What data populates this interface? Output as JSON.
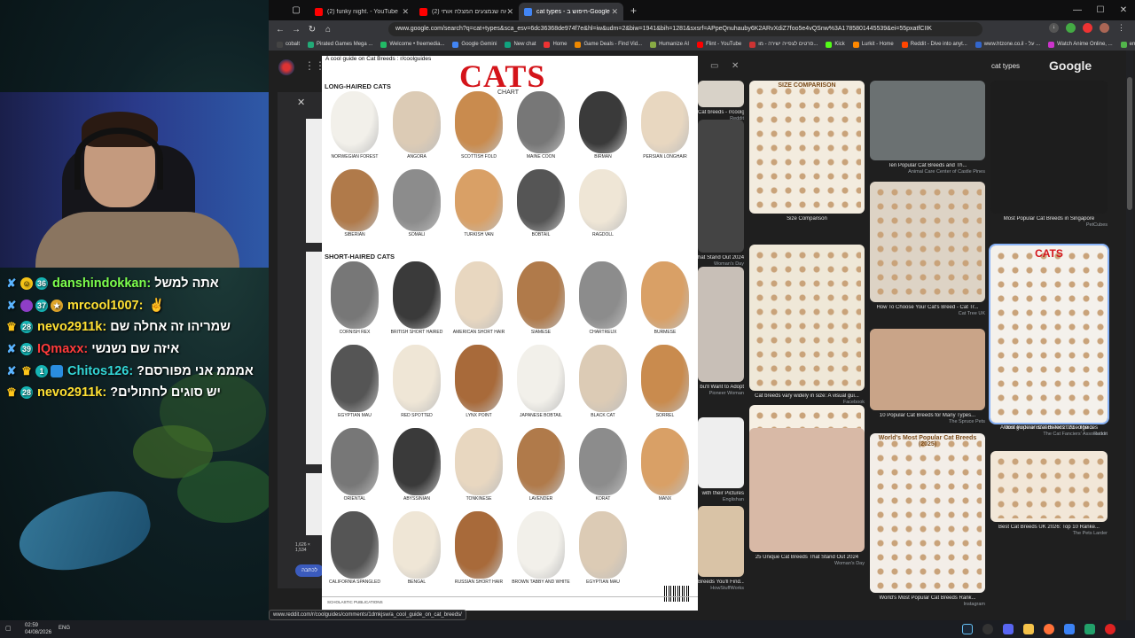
{
  "browser": {
    "tabs": [
      {
        "label": "(2) funky night. - YouTube",
        "color": "#ff0000",
        "active": false
      },
      {
        "label": "(2) הפיגאה שנמצעים המצלה אותי",
        "color": "#ff0000",
        "active": false
      },
      {
        "label": "cat types - חיפוש ב-Google",
        "color": "#4285f4",
        "active": true
      }
    ],
    "new_tab": "+",
    "address": "www.google.com/search?q=cat+types&sca_esv=6dc36368de974f7e&hl=iw&udm=2&biw=1941&bih=1281&sxsrf=APpeQnuhauby6K2ARvXdiZ7foo5e4vQSnw%3A1785801445539&ei=55pxatfCIIK",
    "bookmarks": [
      {
        "label": "cobalt",
        "color": "#444"
      },
      {
        "label": "Pirated Games Mega ...",
        "color": "#2a7"
      },
      {
        "label": "Welcome • freemedia...",
        "color": "#2b6"
      },
      {
        "label": "Google Gemini",
        "color": "#4285f4"
      },
      {
        "label": "New chat",
        "color": "#10a37f"
      },
      {
        "label": "Home",
        "color": "#e33"
      },
      {
        "label": "Game Deals - Find Vid...",
        "color": "#e80"
      },
      {
        "label": "Humanize AI",
        "color": "#8a4"
      },
      {
        "label": "Flint - YouTube",
        "color": "#f00"
      },
      {
        "label": "סרטים לצפייה ישירה - מו...",
        "color": "#c33"
      },
      {
        "label": "Kick",
        "color": "#53fc18"
      },
      {
        "label": "Lurkit - Home",
        "color": "#f80"
      },
      {
        "label": "Reddit - Dive into anyt...",
        "color": "#ff4500"
      },
      {
        "label": "www.htzone.co.il - על ...",
        "color": "#36c"
      },
      {
        "label": "Watch Anime Online, ...",
        "color": "#c3c"
      },
      {
        "label": "embyILTV",
        "color": "#52b54b"
      }
    ]
  },
  "search": {
    "query": "cat types",
    "logo": "Google"
  },
  "preview": {
    "caption": "A cool guide on Cat Breeds : r/coolguides",
    "title": "CATS",
    "subtitle": "CHART",
    "long_haired_label": "LONG-HAIRED CATS",
    "short_haired_label": "SHORT-HAIRED CATS",
    "long_haired": [
      "Norwegian Forest",
      "Angora",
      "Scottish Fold",
      "Maine Coon",
      "Birman",
      "Persian Longhair",
      "Siberian",
      "Somali",
      "Turkish Van",
      "Bobtail",
      "Ragdoll"
    ],
    "short_haired": [
      "Cornish Rex",
      "British Short Haired",
      "American Short Hair",
      "Siamese",
      "Chartreux",
      "Burmese",
      "Egyptian Mau",
      "Red Spotted",
      "Lynx Point",
      "Japanese Bobtail",
      "Black Cat",
      "Sorrel",
      "Oriental",
      "Abyssinian",
      "Tonkinese",
      "Lavender",
      "Korat",
      "Manx",
      "California Spangled",
      "Bengal",
      "Russian Short Hair",
      "Brown Tabby and White",
      "Egyptian Mau"
    ],
    "footer": "SCHOLASTIC PUBLICATIONS"
  },
  "left_panel": {
    "dims": "1,626 × 1,534",
    "pill": "לכתבה"
  },
  "results": [
    {
      "title": "Cat breeds - r/coolguides",
      "source": "Reddit"
    },
    {
      "title": "Size Comparison",
      "source": ""
    },
    {
      "title": "Ten Popular Cat Breeds and Th...",
      "source": "Animal Care Center of Castle Pines"
    },
    {
      "title": "Most Popular Cat Breeds in Singapore",
      "source": "PetCubes"
    },
    {
      "title": "Cat breeds vary widely in size: A visual gui...",
      "source": "Facebook"
    },
    {
      "title": "How To Choose Your Cat's Breed - Cat Tr...",
      "source": "Cat Tree UK"
    },
    {
      "title": "Most Popular Breeds for 2023 - The ...",
      "source": "The Cat Fanciers' Association"
    },
    {
      "title": "The Essential A-Z Cat Breed Guide - Cat Tr...",
      "source": "Cat Tree UK"
    },
    {
      "title": "10 Popular Cat Breeds for Many Types...",
      "source": "The Spruce Pets"
    },
    {
      "title": "A cool guide on Cat Breeds : r/coolguides",
      "source": "Reddit"
    },
    {
      "title": "25 Unique Cat Breeds That Stand Out 2024",
      "source": "Woman's Day"
    },
    {
      "title": "World's Most Popular Cat Breeds Rank...",
      "source": "Instagram"
    },
    {
      "title": "Best Cat Breeds UK 2026: Top 10 Ranke...",
      "source": "The Pets Larder"
    },
    {
      "title": "hat Stand Out 2024",
      "source": "Woman's Day"
    },
    {
      "title": "bu'll Want to Adopt",
      "source": "Pioneer Woman"
    },
    {
      "title": "with their Pictures",
      "source": "Englishan"
    },
    {
      "title": "Breeds You'll Find...",
      "source": "HowStuffWorks"
    }
  ],
  "result_headlines": {
    "size_comparison": "SIZE COMPARISON",
    "cats": "CATS",
    "worlds_popular": "World's Most Popular Cat Breeds (2025)"
  },
  "status_url": "www.reddit.com/r/coolguides/comments/1dmkjsw/a_cool_guide_on_cat_breeds/",
  "chat": [
    {
      "user": "danshindokkan",
      "message": "אתה למשל",
      "user_color": "#7dff4d",
      "badges": [
        "sword",
        "smile",
        "36"
      ]
    },
    {
      "user": "mrcool1007",
      "message": "",
      "user_color": "#ffe033",
      "badges": [
        "sword",
        "circle",
        "37",
        "gold"
      ]
    },
    {
      "user": "nevo2911k",
      "message": "שמריהו זה אחלה שם",
      "user_color": "#ffe033",
      "badges": [
        "crown",
        "28"
      ]
    },
    {
      "user": "IQmaxx",
      "message": "איזה שם נשנשי",
      "user_color": "#ff3b3b",
      "badges": [
        "sword",
        "39"
      ]
    },
    {
      "user": "Chitos126",
      "message": "אמממ אני מפורסם?",
      "user_color": "#33d6d6",
      "badges": [
        "sword",
        "crown",
        "1",
        "cube"
      ]
    },
    {
      "user": "nevo2911k",
      "message": "יש סוגים לחתולים?",
      "user_color": "#ffe033",
      "badges": [
        "crown",
        "28"
      ]
    }
  ],
  "clock": {
    "time": "02:59",
    "date": "04/08/2026",
    "lang": "ENG"
  }
}
